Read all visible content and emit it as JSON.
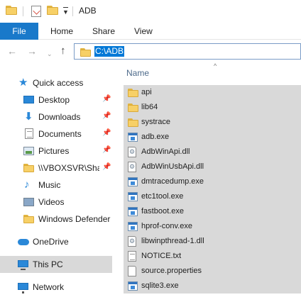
{
  "window": {
    "title": "ADB"
  },
  "ribbon": {
    "tabs": [
      {
        "label": "File"
      },
      {
        "label": "Home"
      },
      {
        "label": "Share"
      },
      {
        "label": "View"
      }
    ]
  },
  "navigation": {
    "back_icon": "back-arrow-icon",
    "forward_icon": "forward-arrow-icon",
    "recent_icon": "chevron-down-icon",
    "up_icon": "up-arrow-icon",
    "address": "C:\\ADB"
  },
  "sidebar": {
    "items": [
      {
        "label": "Quick access",
        "icon": "star-icon",
        "pinned": false
      },
      {
        "label": "Desktop",
        "icon": "desktop-icon",
        "pinned": true
      },
      {
        "label": "Downloads",
        "icon": "download-icon",
        "pinned": true
      },
      {
        "label": "Documents",
        "icon": "documents-icon",
        "pinned": true
      },
      {
        "label": "Pictures",
        "icon": "pictures-icon",
        "pinned": true
      },
      {
        "label": "\\\\VBOXSVR\\Shar",
        "icon": "network-share-icon",
        "pinned": true
      },
      {
        "label": "Music",
        "icon": "music-icon",
        "pinned": false
      },
      {
        "label": "Videos",
        "icon": "videos-icon",
        "pinned": false
      },
      {
        "label": "Windows Defender",
        "icon": "folder-icon",
        "pinned": false
      },
      {
        "label": "OneDrive",
        "icon": "cloud-icon",
        "pinned": false
      },
      {
        "label": "This PC",
        "icon": "computer-icon",
        "pinned": false,
        "selected": true
      },
      {
        "label": "Network",
        "icon": "network-icon",
        "pinned": false
      }
    ]
  },
  "file_list": {
    "column_header": "Name",
    "sort": "ascending",
    "files": [
      {
        "name": "api",
        "type": "folder"
      },
      {
        "name": "lib64",
        "type": "folder"
      },
      {
        "name": "systrace",
        "type": "folder"
      },
      {
        "name": "adb.exe",
        "type": "exe"
      },
      {
        "name": "AdbWinApi.dll",
        "type": "dll"
      },
      {
        "name": "AdbWinUsbApi.dll",
        "type": "dll"
      },
      {
        "name": "dmtracedump.exe",
        "type": "exe"
      },
      {
        "name": "etc1tool.exe",
        "type": "exe"
      },
      {
        "name": "fastboot.exe",
        "type": "exe"
      },
      {
        "name": "hprof-conv.exe",
        "type": "exe"
      },
      {
        "name": "libwinpthread-1.dll",
        "type": "dll"
      },
      {
        "name": "NOTICE.txt",
        "type": "txt"
      },
      {
        "name": "source.properties",
        "type": "file"
      },
      {
        "name": "sqlite3.exe",
        "type": "exe"
      }
    ]
  }
}
